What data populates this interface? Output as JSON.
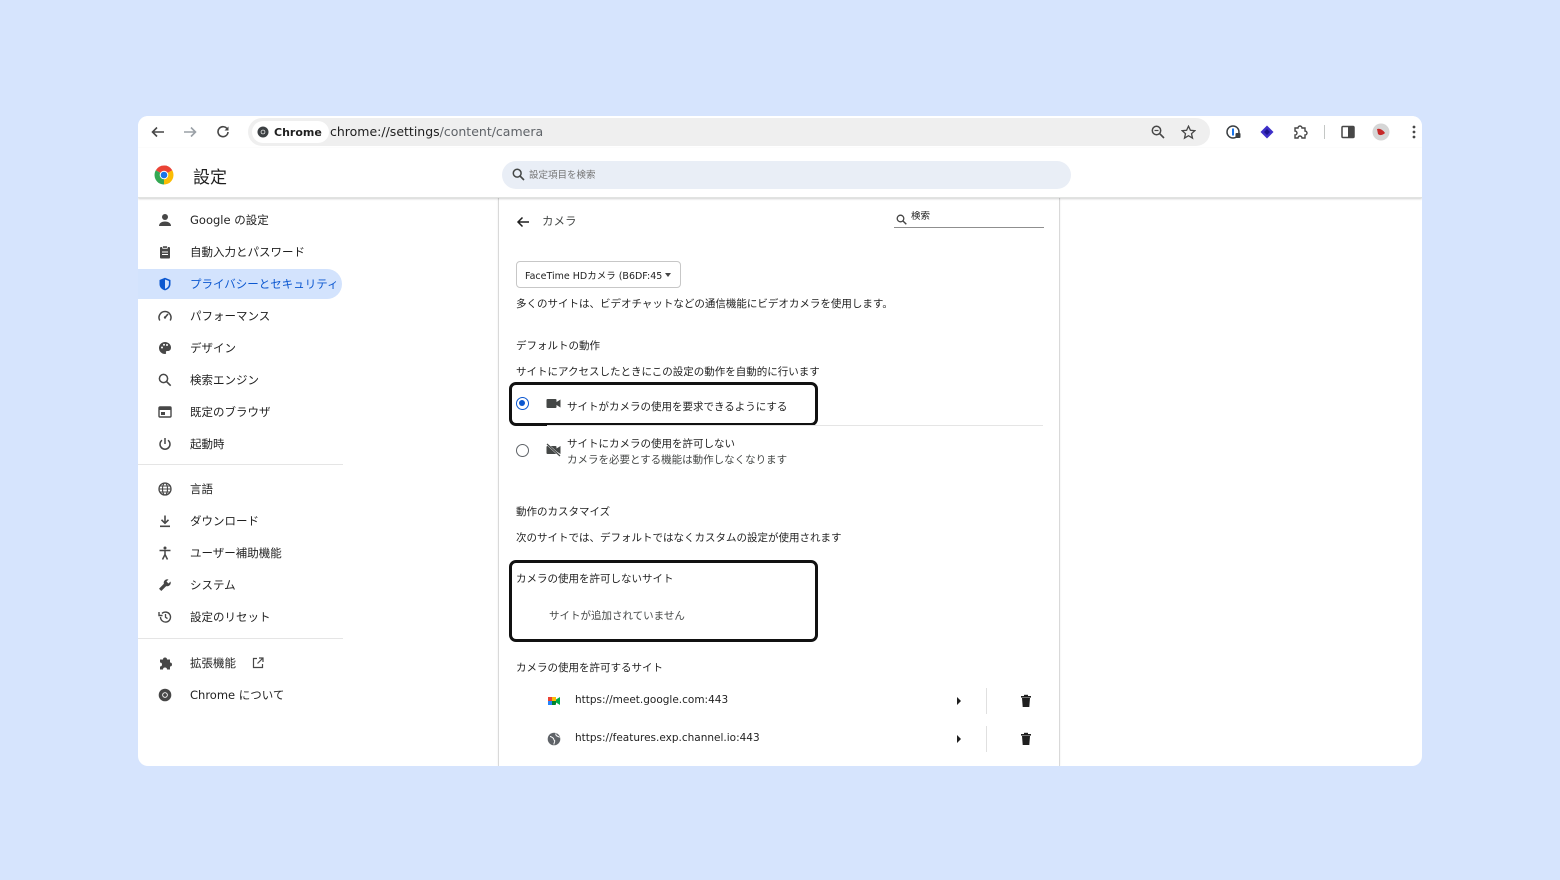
{
  "browser": {
    "chip_label": "Chrome",
    "url_host": "chrome://settings",
    "url_path": "/content/camera"
  },
  "header": {
    "title": "設定",
    "search_placeholder": "設定項目を検索"
  },
  "sidebar": {
    "items": [
      {
        "label": "Google の設定",
        "icon": "person-icon"
      },
      {
        "label": "自動入力とパスワード",
        "icon": "clipboard-icon"
      },
      {
        "label": "プライバシーとセキュリティ",
        "icon": "shield-icon",
        "active": true
      },
      {
        "label": "パフォーマンス",
        "icon": "speedometer-icon"
      },
      {
        "label": "デザイン",
        "icon": "palette-icon"
      },
      {
        "label": "検索エンジン",
        "icon": "search-icon"
      },
      {
        "label": "既定のブラウザ",
        "icon": "browser-window-icon"
      },
      {
        "label": "起動時",
        "icon": "power-icon"
      },
      {
        "label": "言語",
        "icon": "globe-icon"
      },
      {
        "label": "ダウンロード",
        "icon": "download-icon"
      },
      {
        "label": "ユーザー補助機能",
        "icon": "accessibility-icon"
      },
      {
        "label": "システム",
        "icon": "wrench-icon"
      },
      {
        "label": "設定のリセット",
        "icon": "history-icon"
      },
      {
        "label": "拡張機能",
        "icon": "puzzle-icon"
      },
      {
        "label": "Chrome について",
        "icon": "chrome-logo-icon"
      }
    ]
  },
  "camera_page": {
    "title": "カメラ",
    "search_placeholder": "検索",
    "device": "FaceTime HDカメラ (B6DF:45",
    "description": "多くのサイトは、ビデオチャットなどの通信機能にビデオカメラを使用します。",
    "default_heading": "デフォルトの動作",
    "default_sub": "サイトにアクセスしたときにこの設定の動作を自動的に行います",
    "option_allow": "サイトがカメラの使用を要求できるようにする",
    "option_block": "サイトにカメラの使用を許可しない",
    "option_block_sub": "カメラを必要とする機能は動作しなくなります",
    "custom_heading": "動作のカスタマイズ",
    "custom_sub": "次のサイトでは、デフォルトではなくカスタムの設定が使用されます",
    "blocked_heading": "カメラの使用を許可しないサイト",
    "blocked_empty": "サイトが追加されていません",
    "allowed_heading": "カメラの使用を許可するサイト",
    "allowed_sites": [
      {
        "url": "https://meet.google.com:443",
        "icon": "google-meet-icon"
      },
      {
        "url": "https://features.exp.channel.io:443",
        "icon": "globe-icon"
      }
    ]
  },
  "colors": {
    "accent": "#0b57d0",
    "active_bg": "#d3e3fd",
    "page_bg": "#d6e4fd"
  }
}
